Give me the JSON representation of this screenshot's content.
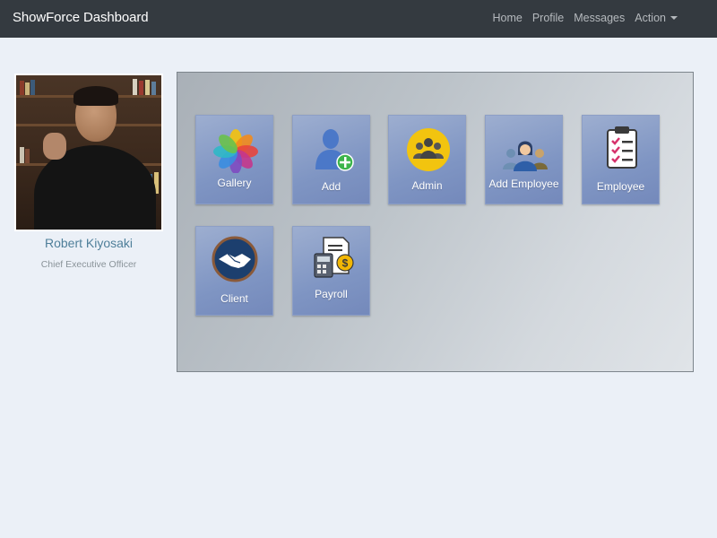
{
  "navbar": {
    "brand": "ShowForce Dashboard",
    "links": [
      "Home",
      "Profile",
      "Messages",
      "Action"
    ]
  },
  "profile": {
    "name": "Robert Kiyosaki",
    "title": "Chief Executive Officer"
  },
  "tiles": [
    {
      "label": "Gallery",
      "icon": "gallery-icon"
    },
    {
      "label": "Add",
      "icon": "add-user-icon"
    },
    {
      "label": "Admin",
      "icon": "admin-group-icon"
    },
    {
      "label": "Add Employee",
      "icon": "add-employee-icon"
    },
    {
      "label": "Employee",
      "icon": "clipboard-checklist-icon"
    },
    {
      "label": "Client",
      "icon": "handshake-icon"
    },
    {
      "label": "Payroll",
      "icon": "payroll-icon"
    }
  ],
  "colors": {
    "navbar": "#343a40",
    "page_background": "#ebf0f7",
    "tile": "#7f95c3",
    "profile_name": "#4f7f9a"
  }
}
